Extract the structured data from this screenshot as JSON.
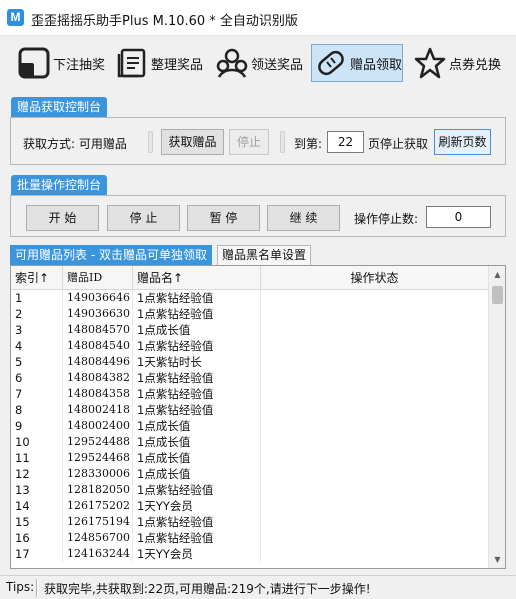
{
  "window": {
    "title": "歪歪摇摇乐助手Plus M.10.60 * 全自动识别版"
  },
  "toolbar": {
    "items": [
      {
        "label": "下注抽奖",
        "icon": "bet-lottery-icon",
        "active": false
      },
      {
        "label": "整理奖品",
        "icon": "organize-prizes-icon",
        "active": false
      },
      {
        "label": "领送奖品",
        "icon": "give-prizes-icon",
        "active": false
      },
      {
        "label": "赠品领取",
        "icon": "gift-claim-icon",
        "active": true
      },
      {
        "label": "点券兑换",
        "icon": "star-icon",
        "active": false
      }
    ]
  },
  "claim_panel": {
    "tab_label": "赠品获取控制台",
    "method_label": "获取方式: 可用赠品",
    "fetch_button": "获取赠品",
    "stop_button": "停止",
    "page_prefix": "到第:",
    "page_value": "22",
    "page_suffix": "页停止获取",
    "refresh_button": "刷新页数"
  },
  "batch_panel": {
    "tab_label": "批量操作控制台",
    "start_button": "开 始",
    "stop_button": "停 止",
    "pause_button": "暂 停",
    "continue_button": "继 续",
    "stop_count_label": "操作停止数:",
    "stop_count_value": "0"
  },
  "list_tabs": [
    {
      "label": "可用赠品列表 - 双击赠品可单独领取",
      "active": true
    },
    {
      "label": "赠品黑名单设置",
      "active": false
    }
  ],
  "table": {
    "columns": [
      "索引↑",
      "赠品ID",
      "赠品名↑",
      "操作状态"
    ],
    "rows": [
      [
        "1",
        "149036646",
        "1点紫钻经验值",
        ""
      ],
      [
        "2",
        "149036630",
        "1点紫钻经验值",
        ""
      ],
      [
        "3",
        "148084570",
        "1点成长值",
        ""
      ],
      [
        "4",
        "148084540",
        "1点紫钻经验值",
        ""
      ],
      [
        "5",
        "148084496",
        "1天紫钻时长",
        ""
      ],
      [
        "6",
        "148084382",
        "1点紫钻经验值",
        ""
      ],
      [
        "7",
        "148084358",
        "1点紫钻经验值",
        ""
      ],
      [
        "8",
        "148002418",
        "1点紫钻经验值",
        ""
      ],
      [
        "9",
        "148002400",
        "1点成长值",
        ""
      ],
      [
        "10",
        "129524488",
        "1点成长值",
        ""
      ],
      [
        "11",
        "129524468",
        "1点成长值",
        ""
      ],
      [
        "12",
        "128330006",
        "1点成长值",
        ""
      ],
      [
        "13",
        "128182050",
        "1点紫钻经验值",
        ""
      ],
      [
        "14",
        "126175202",
        "1天YY会员",
        ""
      ],
      [
        "15",
        "126175194",
        "1点紫钻经验值",
        ""
      ],
      [
        "16",
        "124856700",
        "1点紫钻经验值",
        ""
      ],
      [
        "17",
        "124163244",
        "1天YY会员",
        ""
      ]
    ]
  },
  "status": {
    "label": "Tips:",
    "text": "获取完毕,共获取到:22页,可用赠品:219个,请进行下一步操作!"
  }
}
